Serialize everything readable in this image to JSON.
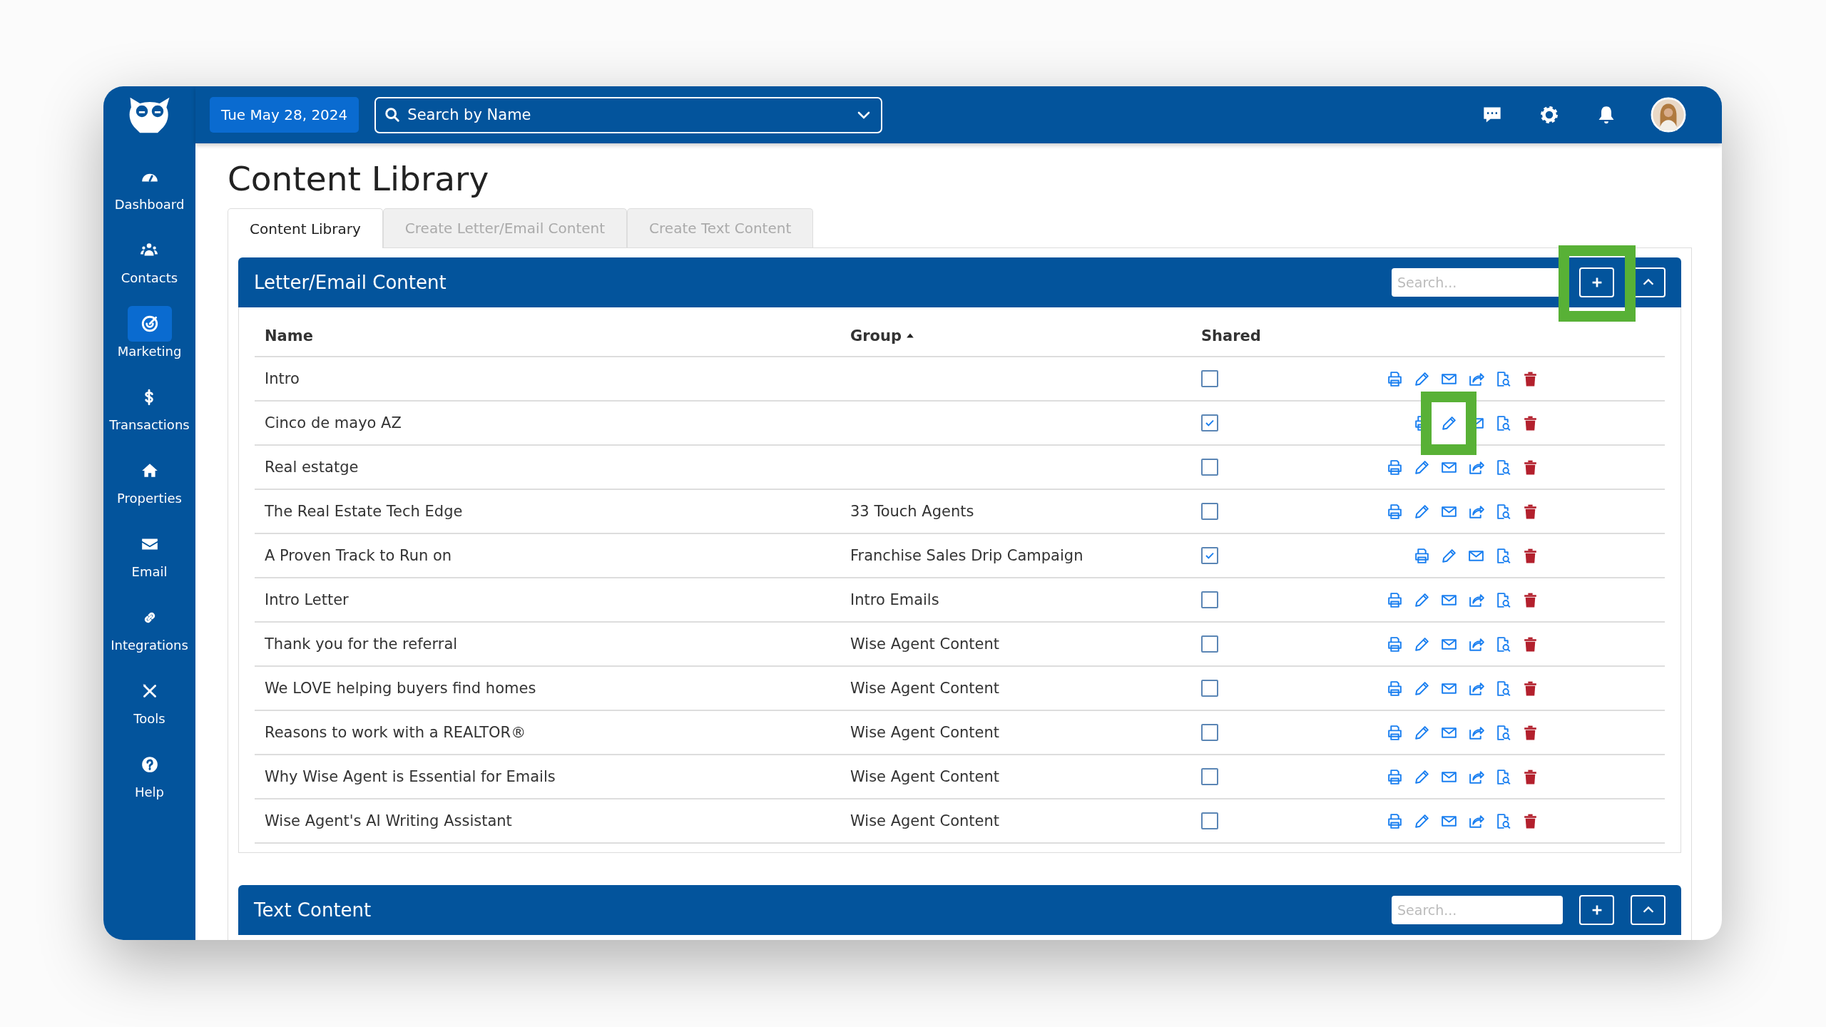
{
  "topbar": {
    "date": "Tue May 28, 2024",
    "search": {
      "placeholder": "Search by Name"
    }
  },
  "sidebar": {
    "items": [
      {
        "label": "Dashboard",
        "kind": "dashboard",
        "selected": false
      },
      {
        "label": "Contacts",
        "kind": "contacts",
        "selected": false
      },
      {
        "label": "Marketing",
        "kind": "marketing",
        "selected": true
      },
      {
        "label": "Transactions",
        "kind": "transactions",
        "selected": false
      },
      {
        "label": "Properties",
        "kind": "properties",
        "selected": false
      },
      {
        "label": "Email",
        "kind": "email",
        "selected": false
      },
      {
        "label": "Integrations",
        "kind": "integrations",
        "selected": false
      },
      {
        "label": "Tools",
        "kind": "tools",
        "selected": false
      },
      {
        "label": "Help",
        "kind": "help",
        "selected": false
      }
    ]
  },
  "page_title": "Content Library",
  "tabs": [
    {
      "label": "Content Library",
      "selected": true
    },
    {
      "label": "Create Letter/Email Content",
      "selected": false
    },
    {
      "label": "Create Text Content",
      "selected": false
    }
  ],
  "sections": [
    {
      "title": "Letter/Email Content",
      "search_placeholder": "Search...",
      "add_highlighted": true,
      "columns": [
        {
          "label": "Name"
        },
        {
          "label": "Group",
          "sorted": true
        },
        {
          "label": "Shared"
        }
      ],
      "rows": [
        {
          "name": "Intro",
          "group": "",
          "shared": false,
          "actions": [
            {
              "kind": "print",
              "highlighted": false
            },
            {
              "kind": "edit",
              "highlighted": false
            },
            {
              "kind": "email",
              "highlighted": false
            },
            {
              "kind": "share",
              "highlighted": false
            },
            {
              "kind": "preview",
              "highlighted": false
            },
            {
              "kind": "delete",
              "highlighted": false
            }
          ]
        },
        {
          "name": "Cinco de mayo AZ",
          "group": "",
          "shared": true,
          "actions": [
            {
              "kind": "print",
              "highlighted": false
            },
            {
              "kind": "edit",
              "highlighted": true
            },
            {
              "kind": "email",
              "highlighted": false
            },
            {
              "kind": "preview",
              "highlighted": false
            },
            {
              "kind": "delete",
              "highlighted": false
            }
          ]
        },
        {
          "name": "Real estatge",
          "group": "",
          "shared": false,
          "actions": [
            {
              "kind": "print",
              "highlighted": false
            },
            {
              "kind": "edit",
              "highlighted": false
            },
            {
              "kind": "email",
              "highlighted": false
            },
            {
              "kind": "share",
              "highlighted": false
            },
            {
              "kind": "preview",
              "highlighted": false
            },
            {
              "kind": "delete",
              "highlighted": false
            }
          ]
        },
        {
          "name": "The Real Estate Tech Edge",
          "group": "33 Touch Agents",
          "shared": false,
          "actions": [
            {
              "kind": "print",
              "highlighted": false
            },
            {
              "kind": "edit",
              "highlighted": false
            },
            {
              "kind": "email",
              "highlighted": false
            },
            {
              "kind": "share",
              "highlighted": false
            },
            {
              "kind": "preview",
              "highlighted": false
            },
            {
              "kind": "delete",
              "highlighted": false
            }
          ]
        },
        {
          "name": "A Proven Track to Run on",
          "group": "Franchise Sales Drip Campaign",
          "shared": true,
          "actions": [
            {
              "kind": "print",
              "highlighted": false
            },
            {
              "kind": "edit",
              "highlighted": false
            },
            {
              "kind": "email",
              "highlighted": false
            },
            {
              "kind": "preview",
              "highlighted": false
            },
            {
              "kind": "delete",
              "highlighted": false
            }
          ]
        },
        {
          "name": "Intro Letter",
          "group": "Intro Emails",
          "shared": false,
          "actions": [
            {
              "kind": "print",
              "highlighted": false
            },
            {
              "kind": "edit",
              "highlighted": false
            },
            {
              "kind": "email",
              "highlighted": false
            },
            {
              "kind": "share",
              "highlighted": false
            },
            {
              "kind": "preview",
              "highlighted": false
            },
            {
              "kind": "delete",
              "highlighted": false
            }
          ]
        },
        {
          "name": "Thank you for the referral",
          "group": "Wise Agent Content",
          "shared": false,
          "actions": [
            {
              "kind": "print",
              "highlighted": false
            },
            {
              "kind": "edit",
              "highlighted": false
            },
            {
              "kind": "email",
              "highlighted": false
            },
            {
              "kind": "share",
              "highlighted": false
            },
            {
              "kind": "preview",
              "highlighted": false
            },
            {
              "kind": "delete",
              "highlighted": false
            }
          ]
        },
        {
          "name": "We LOVE helping buyers find homes",
          "group": "Wise Agent Content",
          "shared": false,
          "actions": [
            {
              "kind": "print",
              "highlighted": false
            },
            {
              "kind": "edit",
              "highlighted": false
            },
            {
              "kind": "email",
              "highlighted": false
            },
            {
              "kind": "share",
              "highlighted": false
            },
            {
              "kind": "preview",
              "highlighted": false
            },
            {
              "kind": "delete",
              "highlighted": false
            }
          ]
        },
        {
          "name": "Reasons to work with a REALTOR®",
          "group": "Wise Agent Content",
          "shared": false,
          "actions": [
            {
              "kind": "print",
              "highlighted": false
            },
            {
              "kind": "edit",
              "highlighted": false
            },
            {
              "kind": "email",
              "highlighted": false
            },
            {
              "kind": "share",
              "highlighted": false
            },
            {
              "kind": "preview",
              "highlighted": false
            },
            {
              "kind": "delete",
              "highlighted": false
            }
          ]
        },
        {
          "name": "Why Wise Agent is Essential for Emails",
          "group": "Wise Agent Content",
          "shared": false,
          "actions": [
            {
              "kind": "print",
              "highlighted": false
            },
            {
              "kind": "edit",
              "highlighted": false
            },
            {
              "kind": "email",
              "highlighted": false
            },
            {
              "kind": "share",
              "highlighted": false
            },
            {
              "kind": "preview",
              "highlighted": false
            },
            {
              "kind": "delete",
              "highlighted": false
            }
          ]
        },
        {
          "name": "Wise Agent's AI Writing Assistant",
          "group": "Wise Agent Content",
          "shared": false,
          "actions": [
            {
              "kind": "print",
              "highlighted": false
            },
            {
              "kind": "edit",
              "highlighted": false
            },
            {
              "kind": "email",
              "highlighted": false
            },
            {
              "kind": "share",
              "highlighted": false
            },
            {
              "kind": "preview",
              "highlighted": false
            },
            {
              "kind": "delete",
              "highlighted": false
            }
          ]
        }
      ]
    },
    {
      "title": "Text Content",
      "search_placeholder": "Search...",
      "add_highlighted": false
    }
  ]
}
